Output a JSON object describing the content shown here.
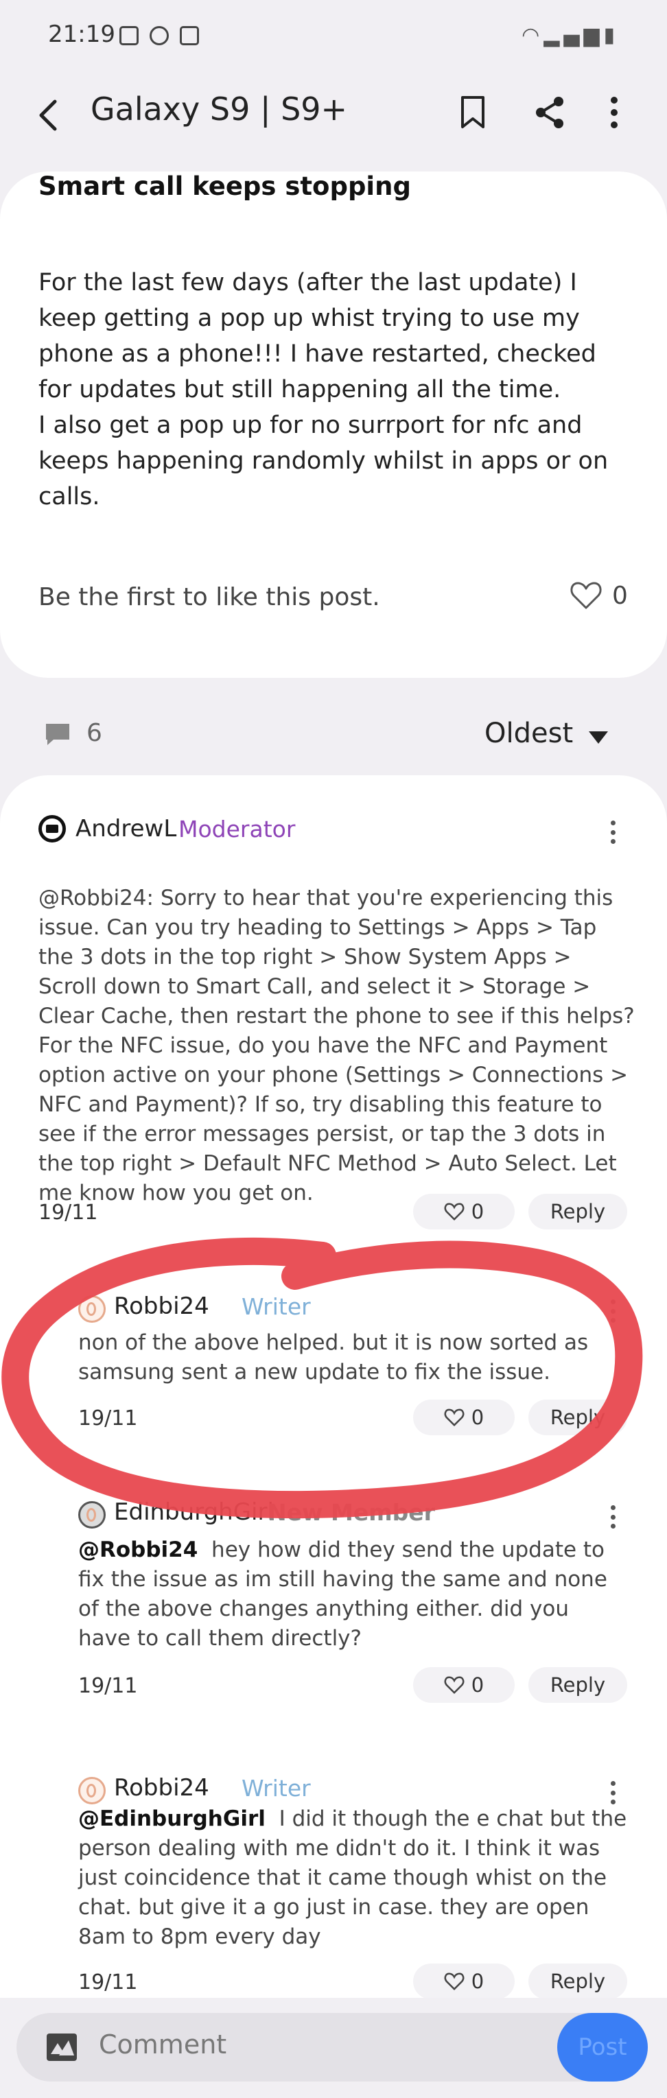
{
  "status_bar": {
    "time": "21:19",
    "left_icons": [
      "gallery-icon",
      "messenger-icon",
      "app-icon"
    ],
    "right_icons": [
      "wifi-icon",
      "signal-icon",
      "battery-charging-icon"
    ]
  },
  "header": {
    "back_icon": "back-arrow-icon",
    "title": "Galaxy S9 | S9+",
    "actions": [
      "bookmark-icon",
      "share-icon",
      "more-icon"
    ]
  },
  "post": {
    "title": "Smart call keeps stopping",
    "body_1": "For the last few days (after the last update) I keep getting a pop up whist trying to use my phone as a phone!!! I have restarted, checked for updates but still happening all the time.",
    "body_2": "I also get a pop up for no surrport for nfc and keeps happening randomly whilst in apps or on calls.",
    "like_text": "Be the first to like this post.",
    "like_count": "0"
  },
  "comments_bar": {
    "count": "6",
    "sort_label": "Oldest"
  },
  "comments": [
    {
      "author": "AndrewL",
      "role": "Moderator",
      "body": "@Robbi24: Sorry to hear that you're experiencing this issue. Can you try heading to Settings > Apps > Tap the 3 dots in the top right > Show System Apps > Scroll down to Smart Call, and select it > Storage > Clear Cache, then restart the phone to see if this helps? For the NFC issue, do you have the NFC and Payment option active on your phone (Settings > Connections > NFC and Payment)? If so, try disabling this feature to see if the error messages persist, or tap the 3 dots in the top right > Default NFC Method > Auto Select. Let me know how you get on.",
      "date": "19/11",
      "likes": "0",
      "reply": "Reply"
    },
    {
      "author": "Robbi24",
      "role": "Writer",
      "body": "non of the above helped. but it is now sorted as samsung sent a new update to fix the issue.",
      "date": "19/11",
      "likes": "0",
      "reply": "Reply"
    },
    {
      "author": "EdinburghGirl",
      "role": "New Member",
      "mention": "@Robbi24",
      "body": "hey how did they send the update to fix the issue as im still having the same and none of the above changes anything either. did you have to call them directly?",
      "date": "19/11",
      "likes": "0",
      "reply": "Reply"
    },
    {
      "author": "Robbi24",
      "role": "Writer",
      "mention": "@EdinburghGirl",
      "body": "I did it though the e chat but the person dealing with me didn't do it. I think it was just coincidence that it came though whist on the chat. but give it a go just in case. they are open 8am to 8pm every day",
      "date": "19/11",
      "likes": "0",
      "reply": "Reply"
    }
  ],
  "composer": {
    "placeholder": "Comment",
    "post_label": "Post"
  },
  "colors": {
    "moderator": "#8e44b7",
    "writer": "#7fb0d8",
    "annotation": "#e8484f",
    "post_button": "#3a7ef5"
  }
}
